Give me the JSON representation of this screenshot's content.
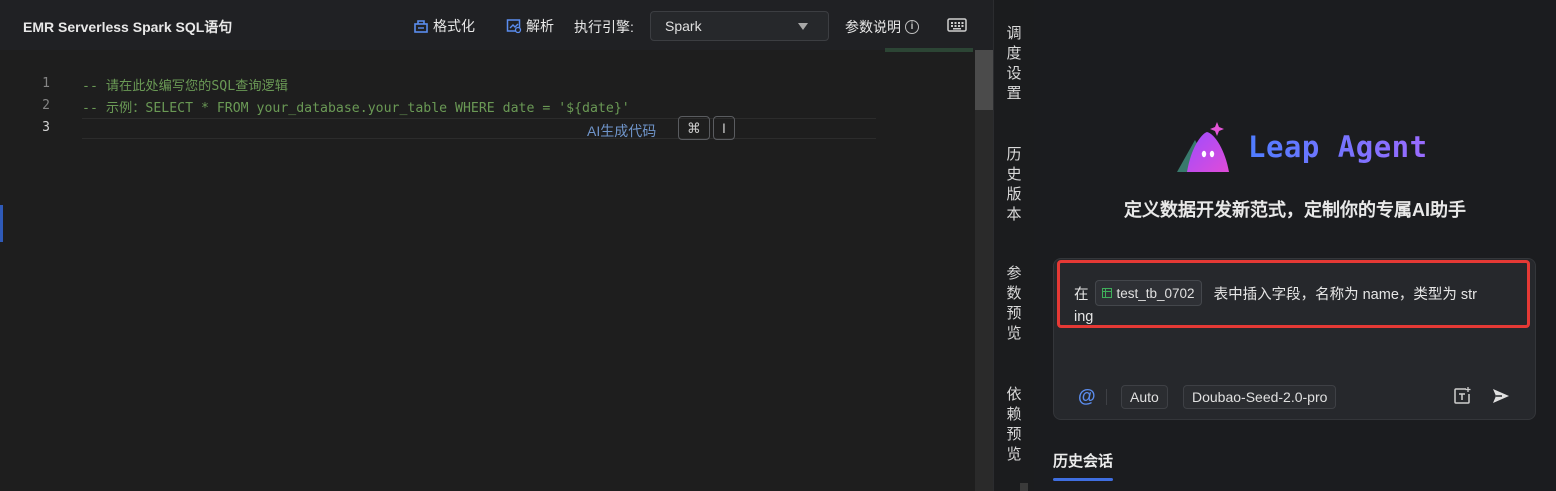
{
  "toolbar": {
    "title": "EMR Serverless Spark SQL语句",
    "format_label": "格式化",
    "parse_label": "解析",
    "engine_label": "执行引擎:",
    "engine_value": "Spark",
    "params_help_label": "参数说明"
  },
  "editor": {
    "lines": [
      {
        "num": "1",
        "text": "-- 请在此处编写您的SQL查询逻辑"
      },
      {
        "num": "2",
        "text": "-- 示例：SELECT * FROM your_database.your_table WHERE date = '${date}'"
      },
      {
        "num": "3",
        "text": ""
      }
    ],
    "ai_hint": "AI生成代码",
    "shortcut_keys": [
      "⌘",
      "I"
    ]
  },
  "side_tabs": [
    {
      "label": "调度设置",
      "chars": [
        "调",
        "度",
        "设",
        "置"
      ]
    },
    {
      "label": "历史版本",
      "chars": [
        "历",
        "史",
        "版",
        "本"
      ]
    },
    {
      "label": "参数预览",
      "chars": [
        "参",
        "数",
        "预",
        "览"
      ]
    },
    {
      "label": "依赖预览",
      "chars": [
        "依",
        "赖",
        "预",
        "览"
      ]
    }
  ],
  "agent": {
    "brand_name": "Leap Agent",
    "tagline": "定义数据开发新范式，定制你的专属AI助手",
    "prompt": {
      "prefix": "在",
      "table_chip": "test_tb_0702",
      "suffix": "表中插入字段，名称为 name，类型为 str",
      "line2": "ing"
    },
    "mode": "Auto",
    "model": "Doubao-Seed-2.0-pro",
    "history_title": "历史会话"
  },
  "colors": {
    "accent": "#3f6ee0",
    "highlight_border": "#e53935",
    "comment_green": "#6a9955"
  }
}
